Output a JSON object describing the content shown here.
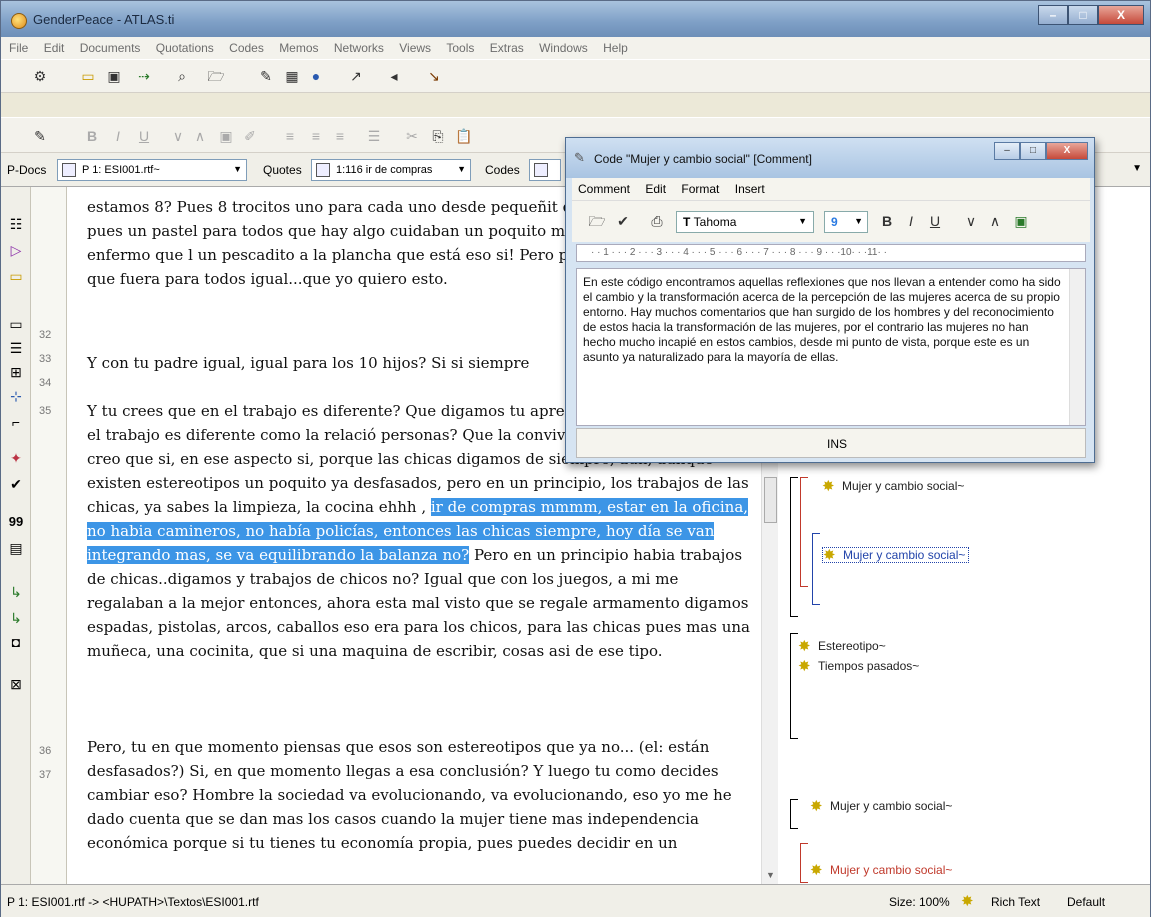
{
  "app": {
    "title": "GenderPeace - ATLAS.ti",
    "caption_min": "–",
    "caption_max": "□",
    "caption_close": "X"
  },
  "menu": [
    "File",
    "Edit",
    "Documents",
    "Quotations",
    "Codes",
    "Memos",
    "Networks",
    "Views",
    "Tools",
    "Extras",
    "Windows",
    "Help"
  ],
  "pdocbar": {
    "pdocs_label": "P-Docs",
    "pdoc_value": "P 1: ESI001.rtf~",
    "quotes_label": "Quotes",
    "quote_value": "1:116 ir de compras",
    "codes_label": "Codes"
  },
  "line_numbers": [
    "32",
    "33",
    "34",
    "35",
    "36",
    "37"
  ],
  "document": {
    "p1": "estamos 8? Pues 8 trocitos uno para cada uno desde pequeñit que hay un pastelito... pues un pastel para todos que hay algo cuidaban un poquito mas cuando alguno había enfermo que l un pescadito a la plancha que está eso si! Pero ponían un poq o huevo, lo que fuera para todos igual...que yo quiero esto.",
    "p2": "Y con tu padre igual, igual para los 10 hijos? Si si siempre",
    "p3_before": "Y tu crees que en el trabajo es diferente? Que digamos tu apre convivir en tu casa y en el trabajo es diferente como la relació personas? Que la convivencia es distinta? Si yo creo que si, en ese aspecto si, porque las chicas digamos de siempre, aun, aunque existen estereotipos un poquito ya desfasados, pero en un principio, los trabajos de las chicas, ya sabes la limpieza, la cocina ehhh , ",
    "p3_highlight": "ir de compras mmmm, estar en la oficina, no habia camineros, no había policías, entonces las chicas siempre, hoy día se van integrando mas, se va equilibrando la balanza no?",
    "p3_after": " Pero en un principio habia trabajos de chicas..digamos y trabajos de chicos no? Igual que con los juegos, a mi me regalaban a la mejor entonces, ahora esta mal visto que se regale armamento digamos espadas, pistolas, arcos, caballos eso era para los chicos, para las chicas pues mas una muñeca, una cocinita, que si una maquina de escribir, cosas asi de ese tipo.",
    "p4": "Pero, tu en que momento piensas que esos son estereotipos que ya no... (el: están desfasados?) Si, en que momento llegas a esa conclusión? Y luego tu como decides cambiar eso? Hombre la sociedad va evolucionando, va evolucionando, eso yo me he dado cuenta que se dan mas los casos cuando la mujer tiene mas independencia económica porque si tu tienes tu economía propia, pues puedes decidir en un"
  },
  "margin_codes": [
    "Mujer y cambio social~",
    "Mujer y cambio social~",
    "Estereotipo~",
    "Tiempos pasados~",
    "Mujer y cambio social~",
    "Mujer y cambio social~"
  ],
  "status": {
    "path": "P 1: ESI001.rtf -> <HUPATH>\\Textos\\ESI001.rtf",
    "size": "Size: 100%",
    "format": "Rich Text",
    "mode": "Default"
  },
  "dialog": {
    "title": "Code \"Mujer y cambio social\" [Comment]",
    "menu": [
      "Comment",
      "Edit",
      "Format",
      "Insert"
    ],
    "font": "Tahoma",
    "font_size": "9",
    "ruler": "· · 1 · · · 2 · · · 3 · · · 4 · · · 5 · · · 6 · · · 7 · · · 8 · · · 9 · · ·10· · ·11· ·",
    "comment": "En este código encontramos aquellas reflexiones que nos llevan a entender como ha sido el cambio y la transformación acerca de la percepción de las mujeres acerca de su propio entorno. Hay muchos comentarios que han surgido de los hombres y del reconocimiento de estos hacia la transformación de las mujeres, por el contrario las mujeres no han hecho mucho incapié en estos cambios, desde mi punto de vista, porque este es un asunto ya naturalizado para la mayoría de ellas.",
    "status": "INS"
  },
  "colors": {
    "highlight": "#3c95e6",
    "code_red": "#c0392b",
    "code_blue": "#2244aa"
  }
}
